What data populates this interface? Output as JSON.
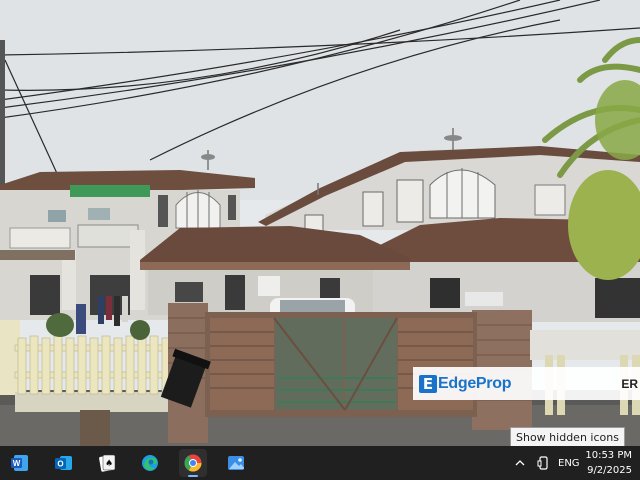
{
  "watermark": {
    "brand": "EdgeProp",
    "logo_letter": "E",
    "trailing_text": "ER"
  },
  "tooltip": {
    "text": "Show hidden icons"
  },
  "taskbar": {
    "apps": [
      {
        "name": "word-icon",
        "letter": "W",
        "color": "#2b579a"
      },
      {
        "name": "outlook-icon",
        "letter": "O",
        "color": "#0f6cbd"
      },
      {
        "name": "solitaire-icon",
        "letter": "♠",
        "color": "#ffffff"
      },
      {
        "name": "edge-icon",
        "color": "#1ea0dc"
      },
      {
        "name": "chrome-icon",
        "color": "#e8453c"
      },
      {
        "name": "photos-icon",
        "color": "#3a8ee6"
      }
    ],
    "tray": {
      "chevron_icon": "chevron-up-icon",
      "device_icon": "phone-link-icon",
      "language": "ENG"
    },
    "clock": {
      "time": "10:53 PM",
      "date": "9/2/2025"
    }
  },
  "colors": {
    "sky": "#e8ecee",
    "roof": "#6b4a3a",
    "wall": "#d9d7d2",
    "gate": "#8a6a55",
    "fence": "#e9e2b8",
    "brand_blue": "#1a73c8",
    "taskbar": "#202020"
  }
}
